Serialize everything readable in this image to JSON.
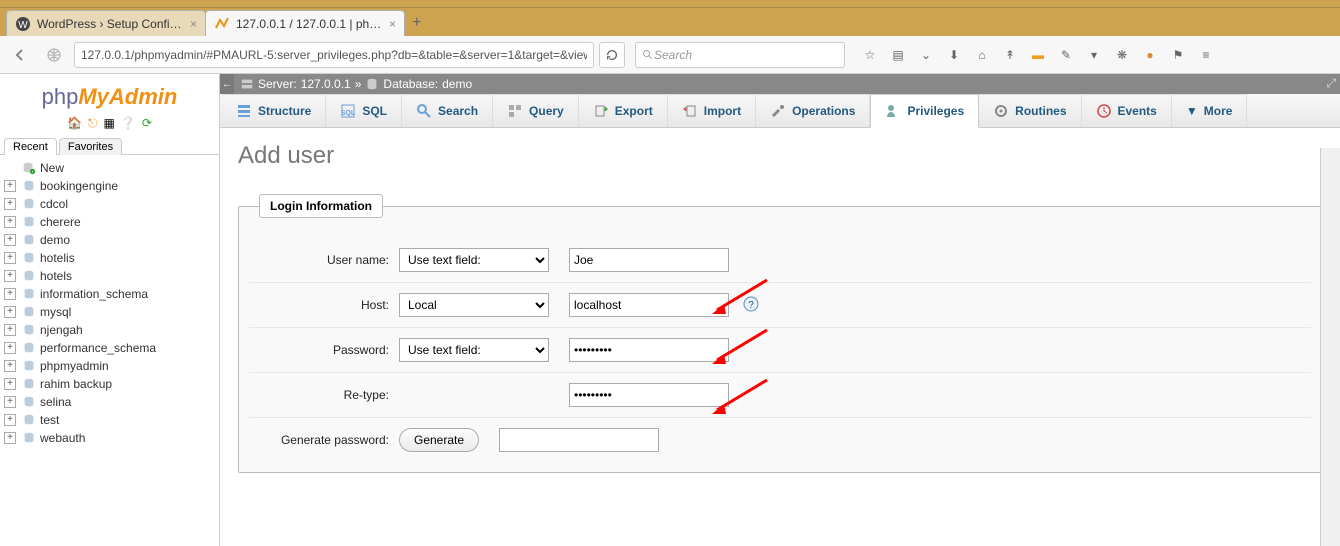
{
  "browser": {
    "tabs": [
      {
        "title": "WordPress › Setup Configurati...",
        "active": false
      },
      {
        "title": "127.0.0.1 / 127.0.0.1 | php...",
        "active": true
      }
    ],
    "address": "127.0.0.1/phpmyadmin/#PMAURL-5:server_privileges.php?db=&table=&server=1&target=&viewing_r",
    "search_placeholder": "Search"
  },
  "logo": {
    "part1": "php",
    "part2": "My",
    "part3": "Admin"
  },
  "sidebar_tabs": {
    "recent": "Recent",
    "favorites": "Favorites"
  },
  "tree": [
    "New",
    "bookingengine",
    "cdcol",
    "cherere",
    "demo",
    "hotelis",
    "hotels",
    "information_schema",
    "mysql",
    "njengah",
    "performance_schema",
    "phpmyadmin",
    "rahim backup",
    "selina",
    "test",
    "webauth"
  ],
  "breadcrumb": {
    "server_label": "Server:",
    "server": "127.0.0.1",
    "db_label": "Database:",
    "db": "demo"
  },
  "main_tabs": {
    "structure": "Structure",
    "sql": "SQL",
    "search": "Search",
    "query": "Query",
    "export": "Export",
    "import": "Import",
    "operations": "Operations",
    "privileges": "Privileges",
    "routines": "Routines",
    "events": "Events",
    "more": "More"
  },
  "page": {
    "title": "Add user"
  },
  "fieldset": {
    "legend": "Login Information"
  },
  "form": {
    "username_label": "User name:",
    "username_select": "Use text field:",
    "username_value": "Joe",
    "host_label": "Host:",
    "host_select": "Local",
    "host_value": "localhost",
    "password_label": "Password:",
    "password_select": "Use text field:",
    "password_value": "•••••••••",
    "retype_label": "Re-type:",
    "retype_value": "•••••••••",
    "generate_label": "Generate password:",
    "generate_button": "Generate",
    "generate_value": ""
  }
}
